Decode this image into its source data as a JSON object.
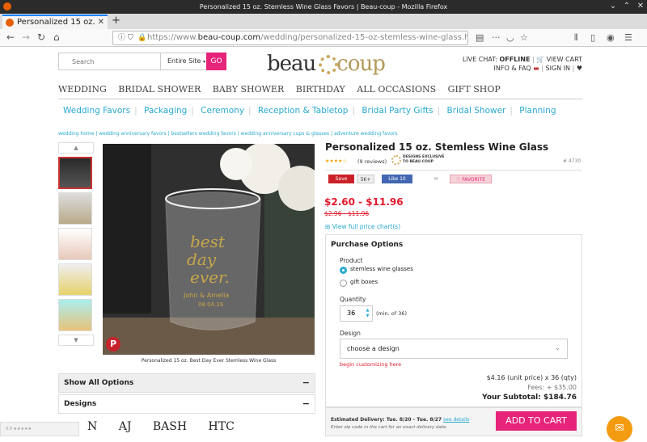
{
  "browser": {
    "window_title": "Personalized 15 oz. Stemless Wine Glass Favors | Beau-coup - Mozilla Firefox",
    "tab_title": "Personalized 15 oz.",
    "url_prefix": "https://www.",
    "url_domain": "beau-coup.com",
    "url_path": "/wedding/personalized-15-oz-stemless-wine-glass.htm?..."
  },
  "header": {
    "search_placeholder": "Search",
    "search_scope": "Entire Site",
    "go_label": "GO",
    "logo_left": "beau",
    "logo_right": "coup",
    "live_chat": "LIVE CHAT:",
    "live_status": "OFFLINE",
    "view_cart": "VIEW CART",
    "info_faq": "INFO & FAQ",
    "sign_in": "SIGN IN"
  },
  "main_nav": [
    "WEDDING",
    "BRIDAL SHOWER",
    "BABY SHOWER",
    "BIRTHDAY",
    "ALL OCCASIONS",
    "GIFT SHOP"
  ],
  "sub_nav": [
    "Wedding Favors",
    "Packaging",
    "Ceremony",
    "Reception & Tabletop",
    "Bridal Party Gifts",
    "Bridal Shower",
    "Planning"
  ],
  "breadcrumb": "wedding home | wedding anniversary favors | bestsellers wedding favors | wedding anniversary cups & glasses | adventure wedding favors",
  "image": {
    "caption": "Personalized 15 oz. Best Day Ever Stemless Wine Glass",
    "glass_text_1": "best",
    "glass_text_2": "day",
    "glass_text_3": "ever.",
    "glass_names": "John & Amelia",
    "glass_date": "08.04.16"
  },
  "accordion": {
    "show_all": "Show All Options",
    "designs": "Designs",
    "design_samples": [
      "N",
      "AJ",
      "BASH",
      "HTC"
    ]
  },
  "product": {
    "title": "Personalized 15 oz. Stemless Wine Glass",
    "stars": "★★★★☆",
    "reviews": "(9 reviews)",
    "exclusive": "DESIGNS EXCLUSIVE TO BEAU-COUP",
    "sku": "# 4730",
    "save": "Save",
    "save_count": "5K+",
    "like": "Like 10",
    "favorite": "FAVORITE",
    "price": "$2.60 - $11.96",
    "old_price": "$2.96 - $11.96",
    "chart_link": "View full price chart(s)"
  },
  "options": {
    "heading": "Purchase Options",
    "product_label": "Product",
    "opt1": "stemless wine glasses",
    "opt2": "gift boxes",
    "quantity_label": "Quantity",
    "quantity": "36",
    "min_note": "(min. of 36)",
    "design_label": "Design",
    "design_value": "choose a design",
    "begin": "begin customizing here",
    "unit_line": "$4.16 (unit price) x 36 (qty)",
    "fees": "Fees: + $35.00",
    "subtotal": "Your Subtotal: $184.76"
  },
  "footer": {
    "est_delivery": "Estimated Delivery: Tue. 8/20 - Tue. 8/27",
    "see_details": "see details",
    "note": "Enter zip code in the cart for an exact delivery date.",
    "add_to_cart": "ADD TO CART",
    "rating": "0.0 ★★★★★"
  },
  "colors": {
    "accent_pink": "#e6247a",
    "link_blue": "#29a9cf",
    "price_red": "#e21a2c"
  }
}
